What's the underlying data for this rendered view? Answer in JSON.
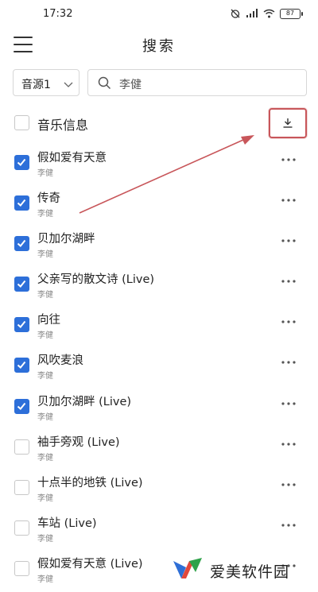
{
  "status_bar": {
    "time": "17:32",
    "battery": "87",
    "icons": [
      "silent-alarm-icon",
      "signal-icon",
      "wifi-icon",
      "battery-icon"
    ]
  },
  "header": {
    "title": "搜索",
    "menu_icon": "hamburger-menu-icon"
  },
  "search": {
    "source": "音源1",
    "query": "李健"
  },
  "list_header": {
    "label": "音乐信息",
    "download_icon": "download-icon"
  },
  "songs": [
    {
      "title": "假如爱有天意",
      "artist": "李健",
      "checked": true
    },
    {
      "title": "传奇",
      "artist": "李健",
      "checked": true
    },
    {
      "title": "贝加尔湖畔",
      "artist": "李健",
      "checked": true
    },
    {
      "title": "父亲写的散文诗 (Live)",
      "artist": "李健",
      "checked": true
    },
    {
      "title": "向往",
      "artist": "李健",
      "checked": true
    },
    {
      "title": "风吹麦浪",
      "artist": "李健",
      "checked": true
    },
    {
      "title": "贝加尔湖畔 (Live)",
      "artist": "李健",
      "checked": true
    },
    {
      "title": "袖手旁观 (Live)",
      "artist": "李健",
      "checked": false
    },
    {
      "title": "十点半的地铁 (Live)",
      "artist": "李健",
      "checked": false
    },
    {
      "title": "车站 (Live)",
      "artist": "李健",
      "checked": false
    },
    {
      "title": "假如爱有天意 (Live)",
      "artist": "李健",
      "checked": false
    }
  ],
  "colors": {
    "checkbox_on": "#2d6fd9",
    "annotation_red": "#c8565a"
  },
  "watermark": {
    "text": "爱美软件园"
  }
}
